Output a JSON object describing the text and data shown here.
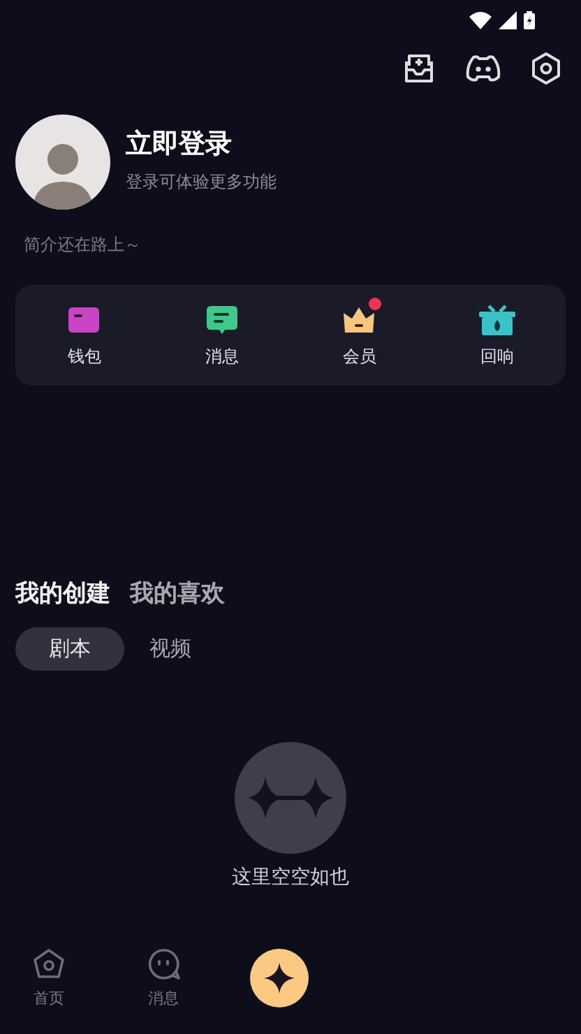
{
  "profile": {
    "name": "立即登录",
    "subtitle": "登录可体验更多功能",
    "bio": "简介还在路上～"
  },
  "shortcuts": [
    {
      "kind": "wallet",
      "label": "钱包",
      "badge": false
    },
    {
      "kind": "message",
      "label": "消息",
      "badge": false
    },
    {
      "kind": "vip",
      "label": "会员",
      "badge": true
    },
    {
      "kind": "echo",
      "label": "回响",
      "badge": false
    }
  ],
  "section_tabs": [
    {
      "label": "我的创建",
      "selected": true
    },
    {
      "label": "我的喜欢",
      "selected": false
    }
  ],
  "sub_tabs": [
    {
      "label": "剧本",
      "selected": true
    },
    {
      "label": "视频",
      "selected": false
    }
  ],
  "empty_state": {
    "text": "这里空空如也"
  },
  "bottom_nav": [
    {
      "kind": "home",
      "label": "首页",
      "selected": false
    },
    {
      "kind": "chat",
      "label": "消息",
      "selected": false
    },
    {
      "kind": "create"
    }
  ]
}
